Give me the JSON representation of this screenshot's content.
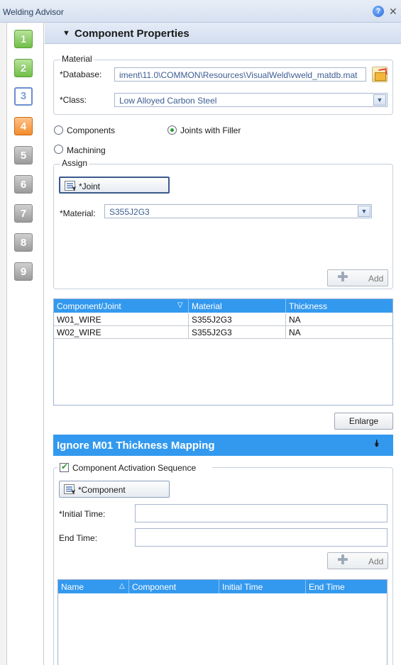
{
  "window": {
    "title": "Welding Advisor"
  },
  "steps": [
    "1",
    "2",
    "3",
    "4",
    "5",
    "6",
    "7",
    "8",
    "9"
  ],
  "component_properties": {
    "header": "Component Properties",
    "material_group": {
      "legend": "Material",
      "database_label": "*Database:",
      "database_value": "iment\\11.0\\COMMON\\Resources\\VisualWeld\\vweld_matdb.mat",
      "class_label": "*Class:",
      "class_value": "Low Alloyed Carbon Steel"
    },
    "mode": {
      "components": "Components",
      "joints_with_filler": "Joints with Filler",
      "machining": "Machining",
      "selected": "joints_with_filler"
    },
    "assign": {
      "legend": "Assign",
      "joint_button": "*Joint",
      "material_label": "*Material:",
      "material_value": "S355J2G3",
      "add_button": "Add"
    },
    "table": {
      "columns": [
        "Component/Joint",
        "Material",
        "Thickness"
      ],
      "rows": [
        [
          "W01_WIRE",
          "S355J2G3",
          "NA"
        ],
        [
          "W02_WIRE",
          "S355J2G3",
          "NA"
        ]
      ]
    },
    "enlarge_button": "Enlarge"
  },
  "thickness_section": {
    "header": "Ignore M01 Thickness Mapping",
    "activation": {
      "checkbox_label": "Component Activation Sequence",
      "checked": true,
      "component_button": "*Component",
      "initial_time_label": "*Initial Time:",
      "initial_time_value": "",
      "end_time_label": "End Time:",
      "end_time_value": "",
      "add_button": "Add"
    },
    "table": {
      "columns": [
        "Name",
        "Component",
        "Initial Time",
        "End Time"
      ]
    }
  }
}
